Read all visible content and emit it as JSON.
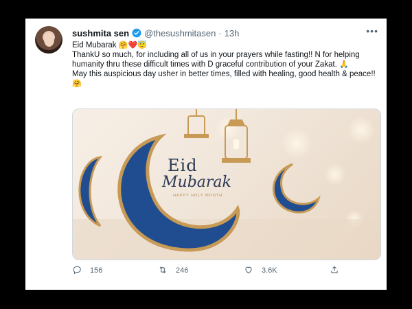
{
  "tweet": {
    "display_name": "sushmita sen",
    "handle": "@thesushmitasen",
    "separator": "·",
    "time": "13h",
    "lines": [
      "Eid Mubarak",
      "ThankU so  much, for including all of us in your prayers while fasting!! N for helping humanity thru these difficult times with D graceful contribution of your Zakat.",
      "May this auspicious day usher in better times, filled with healing, good health & peace!!"
    ],
    "emojis": {
      "line1": "🤗❤️😇",
      "line2": "🙏",
      "line3": "🤗"
    }
  },
  "media": {
    "title": "Eid",
    "subtitle": "Mubarak",
    "tagline": "HAPPY HOLY MONTH",
    "colors": {
      "crescent_blue": "#1f4d8f",
      "gold": "#c79a56",
      "background": "#f3e8dc"
    }
  },
  "actions": {
    "reply_count": "156",
    "retweet_count": "246",
    "like_count": "3.6K",
    "icons": [
      "reply-icon",
      "retweet-icon",
      "like-icon",
      "share-icon"
    ]
  },
  "colors": {
    "verified": "#1d9bf0",
    "text": "#0f1419",
    "muted": "#536471"
  }
}
